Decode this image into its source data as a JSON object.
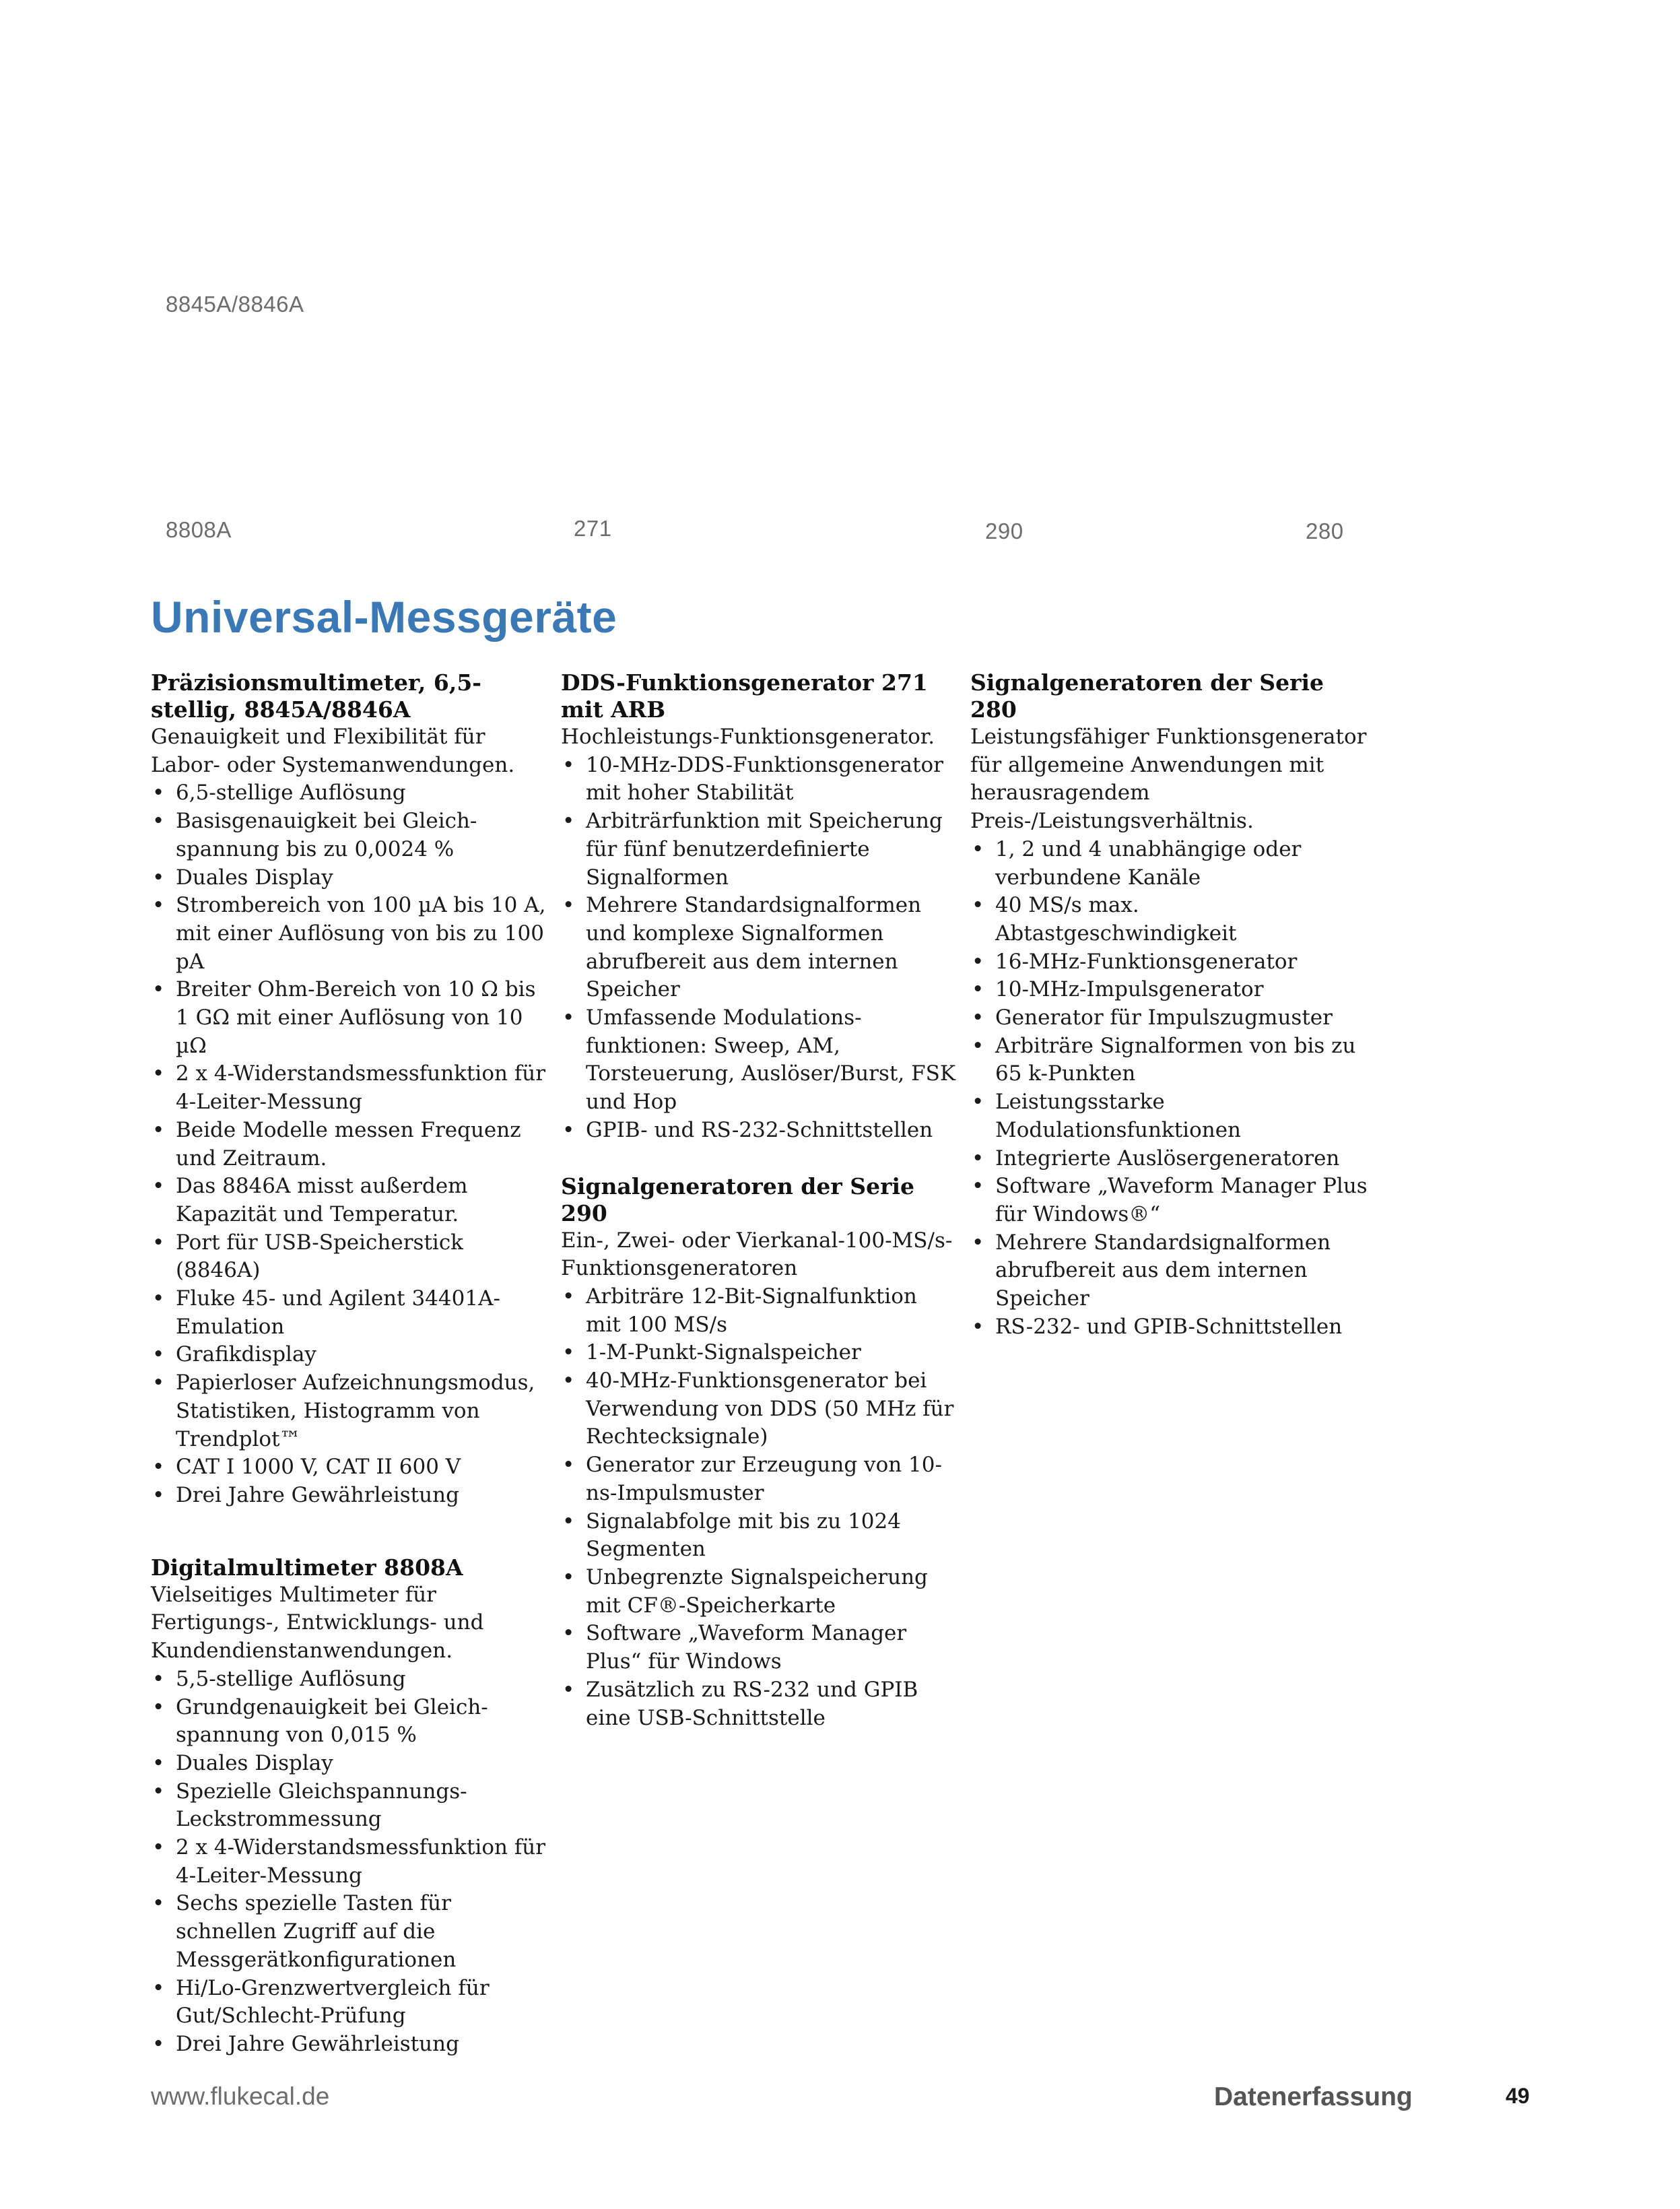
{
  "captions": {
    "c1": "8845A/8846A",
    "c2": "8808A",
    "c3": "271",
    "c4": "290",
    "c5": "280"
  },
  "title": "Universal-Messgeräte",
  "col1": {
    "s1": {
      "title": "Präzisionsmultimeter, 6,5-stellig, 8845A/8846A",
      "intro": "Genauigkeit und Flexibilität für Labor- oder Systemanwendungen.",
      "bullets": [
        "6,5-stellige Auflösung",
        "Basisgenauigkeit bei Gleich-spannung bis zu 0,0024 %",
        "Duales Display",
        "Strombereich von 100 µA bis 10 A, mit einer Auflösung von bis zu 100 pA",
        "Breiter Ohm-Bereich von 10 Ω bis 1 GΩ mit einer Auflösung von 10 µΩ",
        "2 x 4-Widerstandsmessfunktion für 4-Leiter-Messung",
        "Beide Modelle messen Frequenz und Zeitraum.",
        "Das 8846A misst außerdem Kapazität und Temperatur.",
        "Port für USB-Speicherstick (8846A)",
        "Fluke 45- und Agilent 34401A-Emulation",
        "Grafikdisplay",
        "Papierloser Aufzeichnungsmodus, Statistiken, Histogramm von Trendplot™",
        "CAT I 1000 V, CAT II 600 V",
        "Drei Jahre Gewährleistung"
      ]
    },
    "s2": {
      "title": "Digitalmultimeter 8808A",
      "intro": "Vielseitiges Multimeter für Fertigungs-, Entwicklungs- und Kundendienstanwendungen.",
      "bullets": [
        "5,5-stellige Auflösung",
        "Grundgenauigkeit bei Gleich-spannung von 0,015 %",
        "Duales Display",
        "Spezielle Gleichspannungs-Leckstrommessung",
        "2 x 4-Widerstandsmessfunktion für 4-Leiter-Messung",
        "Sechs spezielle Tasten für schnellen Zugriff auf die Messgerätkonfigurationen",
        "Hi/Lo-Grenzwertvergleich für Gut/Schlecht-Prüfung",
        "Drei Jahre Gewährleistung"
      ]
    }
  },
  "col2": {
    "s1": {
      "title": "DDS-Funktionsgenerator 271 mit ARB",
      "intro": "Hochleistungs-Funktionsgenerator.",
      "bullets": [
        "10-MHz-DDS-Funktionsgenerator mit hoher Stabilität",
        "Arbiträrfunktion mit Speicherung für fünf benutzerdefinierte Signalformen",
        "Mehrere Standardsignalformen und komplexe Signalformen abrufbereit aus dem internen Speicher",
        "Umfassende Modulations-funktionen: Sweep, AM, Torsteuerung, Auslöser/Burst, FSK und Hop",
        "GPIB- und RS-232-Schnittstellen"
      ]
    },
    "s2": {
      "title": "Signalgeneratoren der Serie 290",
      "intro": "Ein-, Zwei- oder Vierkanal-100-MS/s-Funktionsgeneratoren",
      "bullets": [
        "Arbiträre 12-Bit-Signalfunktion mit 100 MS/s",
        "1-M-Punkt-Signalspeicher",
        "40-MHz-Funktionsgenerator bei Verwendung von DDS (50 MHz für Rechtecksignale)",
        "Generator zur Erzeugung von 10-ns-Impulsmuster",
        "Signalabfolge mit bis zu 1024 Segmenten",
        "Unbegrenzte Signalspeicherung mit CF®-Speicherkarte",
        "Software „Waveform Manager Plus“ für Windows",
        "Zusätzlich zu RS-232 und GPIB eine USB-Schnittstelle"
      ]
    }
  },
  "col3": {
    "s1": {
      "title": "Signalgeneratoren der Serie 280",
      "intro": "Leistungsfähiger Funktionsgenerator für allgemeine Anwendungen mit herausragendem Preis-/Leistungsverhältnis.",
      "bullets": [
        "1, 2 und 4 unabhängige oder verbundene Kanäle",
        "40 MS/s max. Abtastgeschwindigkeit",
        "16-MHz-Funktionsgenerator",
        "10-MHz-Impulsgenerator",
        "Generator für Impulszugmuster",
        "Arbiträre Signalformen von bis zu 65 k-Punkten",
        "Leistungsstarke Modulationsfunktionen",
        "Integrierte Auslösergeneratoren",
        "Software „Waveform Manager Plus für Windows®“",
        "Mehrere Standardsignalformen abrufbereit aus dem internen Speicher",
        "RS-232- und GPIB-Schnittstellen"
      ]
    }
  },
  "footer": {
    "url": "www.flukecal.de",
    "section": "Datenerfassung",
    "page": "49"
  }
}
